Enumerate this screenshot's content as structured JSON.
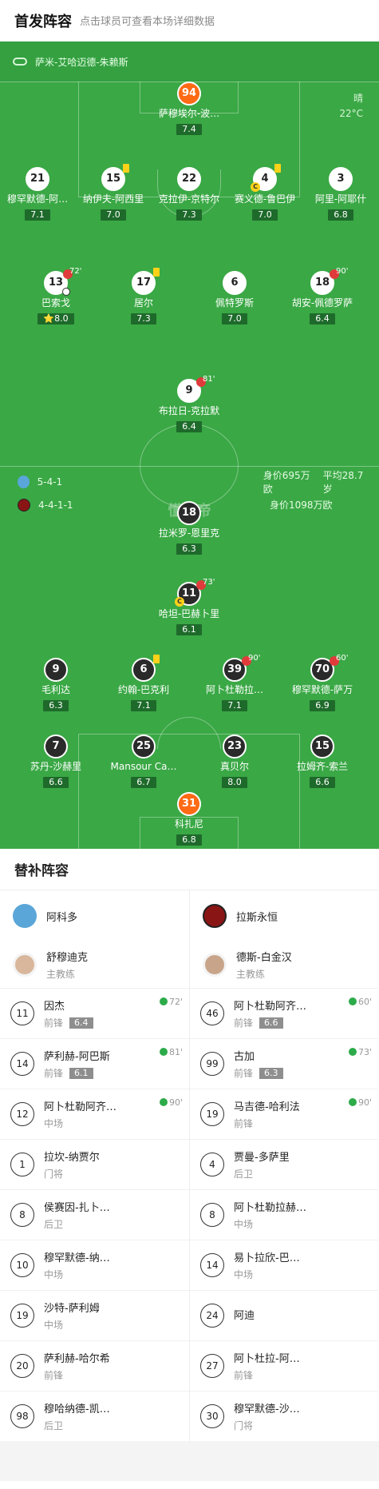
{
  "header": {
    "title": "首发阵容",
    "subtitle": "点击球员可查看本场详细数据"
  },
  "referee": "萨米-艾哈迈德-朱赖斯",
  "weather": {
    "condition": "晴",
    "temp": "22°C"
  },
  "watermark": "懂球帝",
  "home_info": {
    "formation": "5-4-1",
    "worth": "身价695万欧",
    "age": "平均28.7岁"
  },
  "away_info": {
    "formation": "4-4-1-1",
    "worth": "身价1098万欧"
  },
  "home_players": [
    {
      "num": "94",
      "name": "萨穆埃尔-波…",
      "rating": "7.4",
      "gk": true
    },
    {
      "num": "21",
      "name": "穆罕默德-阿…",
      "rating": "7.1"
    },
    {
      "num": "15",
      "name": "纳伊夫-阿西里",
      "rating": "7.0"
    },
    {
      "num": "22",
      "name": "克拉伊-京特尔",
      "rating": "7.3"
    },
    {
      "num": "4",
      "name": "赛义德-鲁巴伊",
      "rating": "7.0"
    },
    {
      "num": "3",
      "name": "阿里-阿耶什",
      "rating": "6.8"
    },
    {
      "num": "13",
      "name": "巴索戈",
      "rating": "⭐8.0",
      "sub": "72'"
    },
    {
      "num": "17",
      "name": "居尔",
      "rating": "7.3"
    },
    {
      "num": "6",
      "name": "佩特罗斯",
      "rating": "7.0"
    },
    {
      "num": "18",
      "name": "胡安-佩德罗萨",
      "rating": "6.4",
      "sub": "90'"
    },
    {
      "num": "9",
      "name": "布拉日-克拉默",
      "rating": "6.4",
      "sub": "81'"
    }
  ],
  "away_players": [
    {
      "num": "18",
      "name": "拉米罗-恩里克",
      "rating": "6.3"
    },
    {
      "num": "11",
      "name": "哈坦-巴赫卜里",
      "rating": "6.1",
      "sub": "73'"
    },
    {
      "num": "9",
      "name": "毛利达",
      "rating": "6.3"
    },
    {
      "num": "6",
      "name": "约翰-巴克利",
      "rating": "7.1"
    },
    {
      "num": "39",
      "name": "阿卜杜勒拉…",
      "rating": "7.1",
      "sub": "90'"
    },
    {
      "num": "70",
      "name": "穆罕默德-萨万",
      "rating": "6.9",
      "sub": "60'"
    },
    {
      "num": "7",
      "name": "苏丹-沙赫里",
      "rating": "6.6"
    },
    {
      "num": "25",
      "name": "Mansour Ca…",
      "rating": "6.7"
    },
    {
      "num": "23",
      "name": "真贝尔",
      "rating": "8.0"
    },
    {
      "num": "15",
      "name": "拉姆齐-索兰",
      "rating": "6.6"
    },
    {
      "num": "31",
      "name": "科扎尼",
      "rating": "6.8",
      "gk": true
    }
  ],
  "subs_title": "替补阵容",
  "home_team": {
    "name": "阿科多",
    "color": "#5aa6d8",
    "coach": "舒穆迪克",
    "coach_role": "主教练"
  },
  "away_team": {
    "name": "拉斯永恒",
    "color": "#a01c1c",
    "coach": "德斯-白金汉",
    "coach_role": "主教练"
  },
  "home_subs": [
    {
      "num": "11",
      "name": "因杰",
      "pos": "前锋",
      "rating": "6.4",
      "time": "72'"
    },
    {
      "num": "14",
      "name": "萨利赫-阿巴斯",
      "pos": "前锋",
      "rating": "6.1",
      "time": "81'"
    },
    {
      "num": "12",
      "name": "阿卜杜勒阿齐…",
      "pos": "中场",
      "time": "90'"
    },
    {
      "num": "1",
      "name": "拉坎-纳贾尔",
      "pos": "门将"
    },
    {
      "num": "8",
      "name": "侯赛因-扎卜…",
      "pos": "后卫"
    },
    {
      "num": "10",
      "name": "穆罕默德-纳…",
      "pos": "中场"
    },
    {
      "num": "19",
      "name": "沙特-萨利姆",
      "pos": "中场"
    },
    {
      "num": "20",
      "name": "萨利赫-哈尔希",
      "pos": "前锋"
    },
    {
      "num": "98",
      "name": "穆哈纳德-凯…",
      "pos": "后卫"
    }
  ],
  "away_subs": [
    {
      "num": "46",
      "name": "阿卜杜勒阿齐…",
      "pos": "前锋",
      "rating": "6.6",
      "time": "60'"
    },
    {
      "num": "99",
      "name": "古加",
      "pos": "前锋",
      "rating": "6.3",
      "time": "73'"
    },
    {
      "num": "19",
      "name": "马吉德-哈利法",
      "pos": "前锋",
      "time": "90'"
    },
    {
      "num": "4",
      "name": "贾曼-多萨里",
      "pos": "后卫"
    },
    {
      "num": "8",
      "name": "阿卜杜勒拉赫…",
      "pos": "中场"
    },
    {
      "num": "14",
      "name": "易卜拉欣-巴…",
      "pos": "中场"
    },
    {
      "num": "24",
      "name": "阿迪",
      "pos": ""
    },
    {
      "num": "27",
      "name": "阿卜杜拉-阿…",
      "pos": "前锋"
    },
    {
      "num": "30",
      "name": "穆罕默德-沙…",
      "pos": "门将"
    }
  ]
}
